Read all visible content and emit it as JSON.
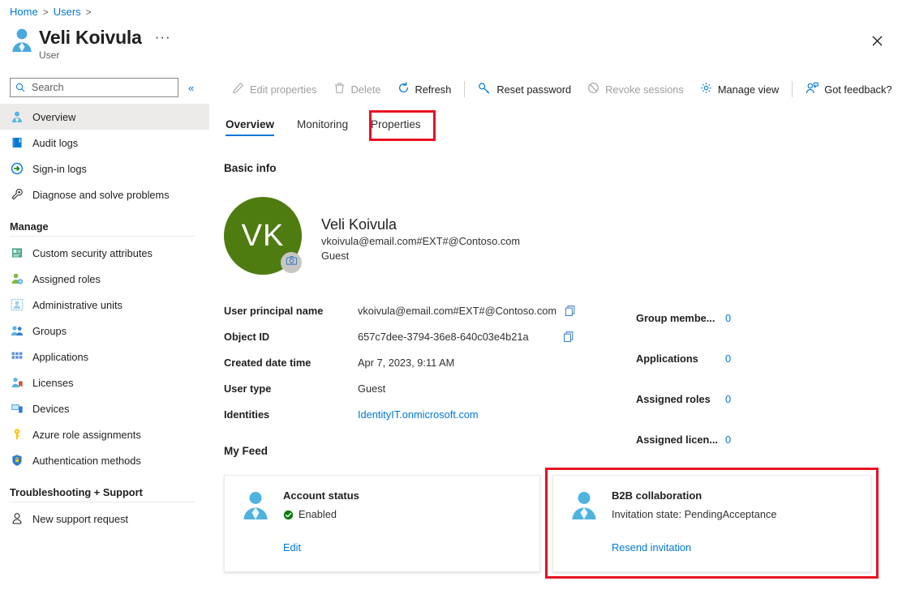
{
  "breadcrumb": {
    "items": [
      {
        "label": "Home"
      },
      {
        "label": "Users"
      }
    ],
    "separator": ">"
  },
  "header": {
    "title": "Veli Koivula",
    "subtitle": "User",
    "more_label": "···",
    "close_label": "✕"
  },
  "search": {
    "placeholder": "Search",
    "value": "",
    "collapse_label": "«"
  },
  "sidebar": {
    "items": [
      {
        "label": "Overview",
        "icon": "user-icon",
        "selected": true
      },
      {
        "label": "Audit logs",
        "icon": "book-icon",
        "selected": false
      },
      {
        "label": "Sign-in logs",
        "icon": "signin-icon",
        "selected": false
      },
      {
        "label": "Diagnose and solve problems",
        "icon": "wrench-icon",
        "selected": false
      }
    ],
    "groups": [
      {
        "label": "Manage",
        "items": [
          {
            "label": "Custom security attributes",
            "icon": "attributes-icon"
          },
          {
            "label": "Assigned roles",
            "icon": "roles-icon"
          },
          {
            "label": "Administrative units",
            "icon": "admin-units-icon"
          },
          {
            "label": "Groups",
            "icon": "groups-icon"
          },
          {
            "label": "Applications",
            "icon": "applications-icon"
          },
          {
            "label": "Licenses",
            "icon": "licenses-icon"
          },
          {
            "label": "Devices",
            "icon": "devices-icon"
          },
          {
            "label": "Azure role assignments",
            "icon": "key-icon"
          },
          {
            "label": "Authentication methods",
            "icon": "shield-icon"
          }
        ]
      },
      {
        "label": "Troubleshooting + Support",
        "items": [
          {
            "label": "New support request",
            "icon": "support-icon"
          }
        ]
      }
    ]
  },
  "commandbar": {
    "items": [
      {
        "label": "Edit properties",
        "icon": "pencil-icon",
        "disabled": true
      },
      {
        "label": "Delete",
        "icon": "trash-icon",
        "disabled": true
      },
      {
        "label": "Refresh",
        "icon": "refresh-icon",
        "disabled": false
      },
      {
        "separator": true
      },
      {
        "label": "Reset password",
        "icon": "key-icon",
        "disabled": false
      },
      {
        "label": "Revoke sessions",
        "icon": "block-icon",
        "disabled": true
      },
      {
        "label": "Manage view",
        "icon": "gear-icon",
        "disabled": false
      },
      {
        "separator": true
      },
      {
        "label": "Got feedback?",
        "icon": "feedback-icon",
        "disabled": false
      }
    ]
  },
  "tabs": [
    {
      "label": "Overview",
      "active": true,
      "highlighted": false
    },
    {
      "label": "Monitoring",
      "active": false,
      "highlighted": false
    },
    {
      "label": "Properties",
      "active": false,
      "highlighted": true
    }
  ],
  "sections": {
    "basic_info": "Basic info",
    "my_feed": "My Feed"
  },
  "identity": {
    "initials": "VK",
    "avatar_color": "#4f7c10",
    "name": "Veli Koivula",
    "upn": "vkoivula@email.com#EXT#@Contoso.com",
    "user_type": "Guest",
    "camera_badge": "camera-icon"
  },
  "details": [
    {
      "label": "User principal name",
      "value": "vkoivula@email.com#EXT#@Contoso.com",
      "copy": true,
      "link": false
    },
    {
      "label": "Object ID",
      "value": "657c7dee-3794-36e8-640c03e4b21a",
      "copy": true,
      "link": false
    },
    {
      "label": "Created date time",
      "value": "Apr 7, 2023, 9:11 AM",
      "copy": false,
      "link": false
    },
    {
      "label": "User type",
      "value": "Guest",
      "copy": false,
      "link": false
    },
    {
      "label": "Identities",
      "value": "IdentityIT.onmicrosoft.com",
      "copy": false,
      "link": true
    }
  ],
  "stats": [
    {
      "label": "Group membe...",
      "value": "0"
    },
    {
      "label": "Applications",
      "value": "0"
    },
    {
      "label": "Assigned roles",
      "value": "0"
    },
    {
      "label": "Assigned licen...",
      "value": "0"
    }
  ],
  "feed": {
    "cards": [
      {
        "title": "Account status",
        "status": "Enabled",
        "status_color": "#107c10",
        "status_icon": "check-circle-icon",
        "link": "Edit",
        "icon": "person-icon",
        "highlighted": false
      },
      {
        "title": "B2B collaboration",
        "status": "Invitation state: PendingAcceptance",
        "status_color": "",
        "status_icon": "",
        "link": "Resend invitation",
        "icon": "person-icon",
        "highlighted": true
      }
    ]
  },
  "colors": {
    "accent": "#0078d4",
    "highlight_red": "#e81123",
    "avatar_green": "#4f7c10",
    "success_green": "#107c10"
  }
}
